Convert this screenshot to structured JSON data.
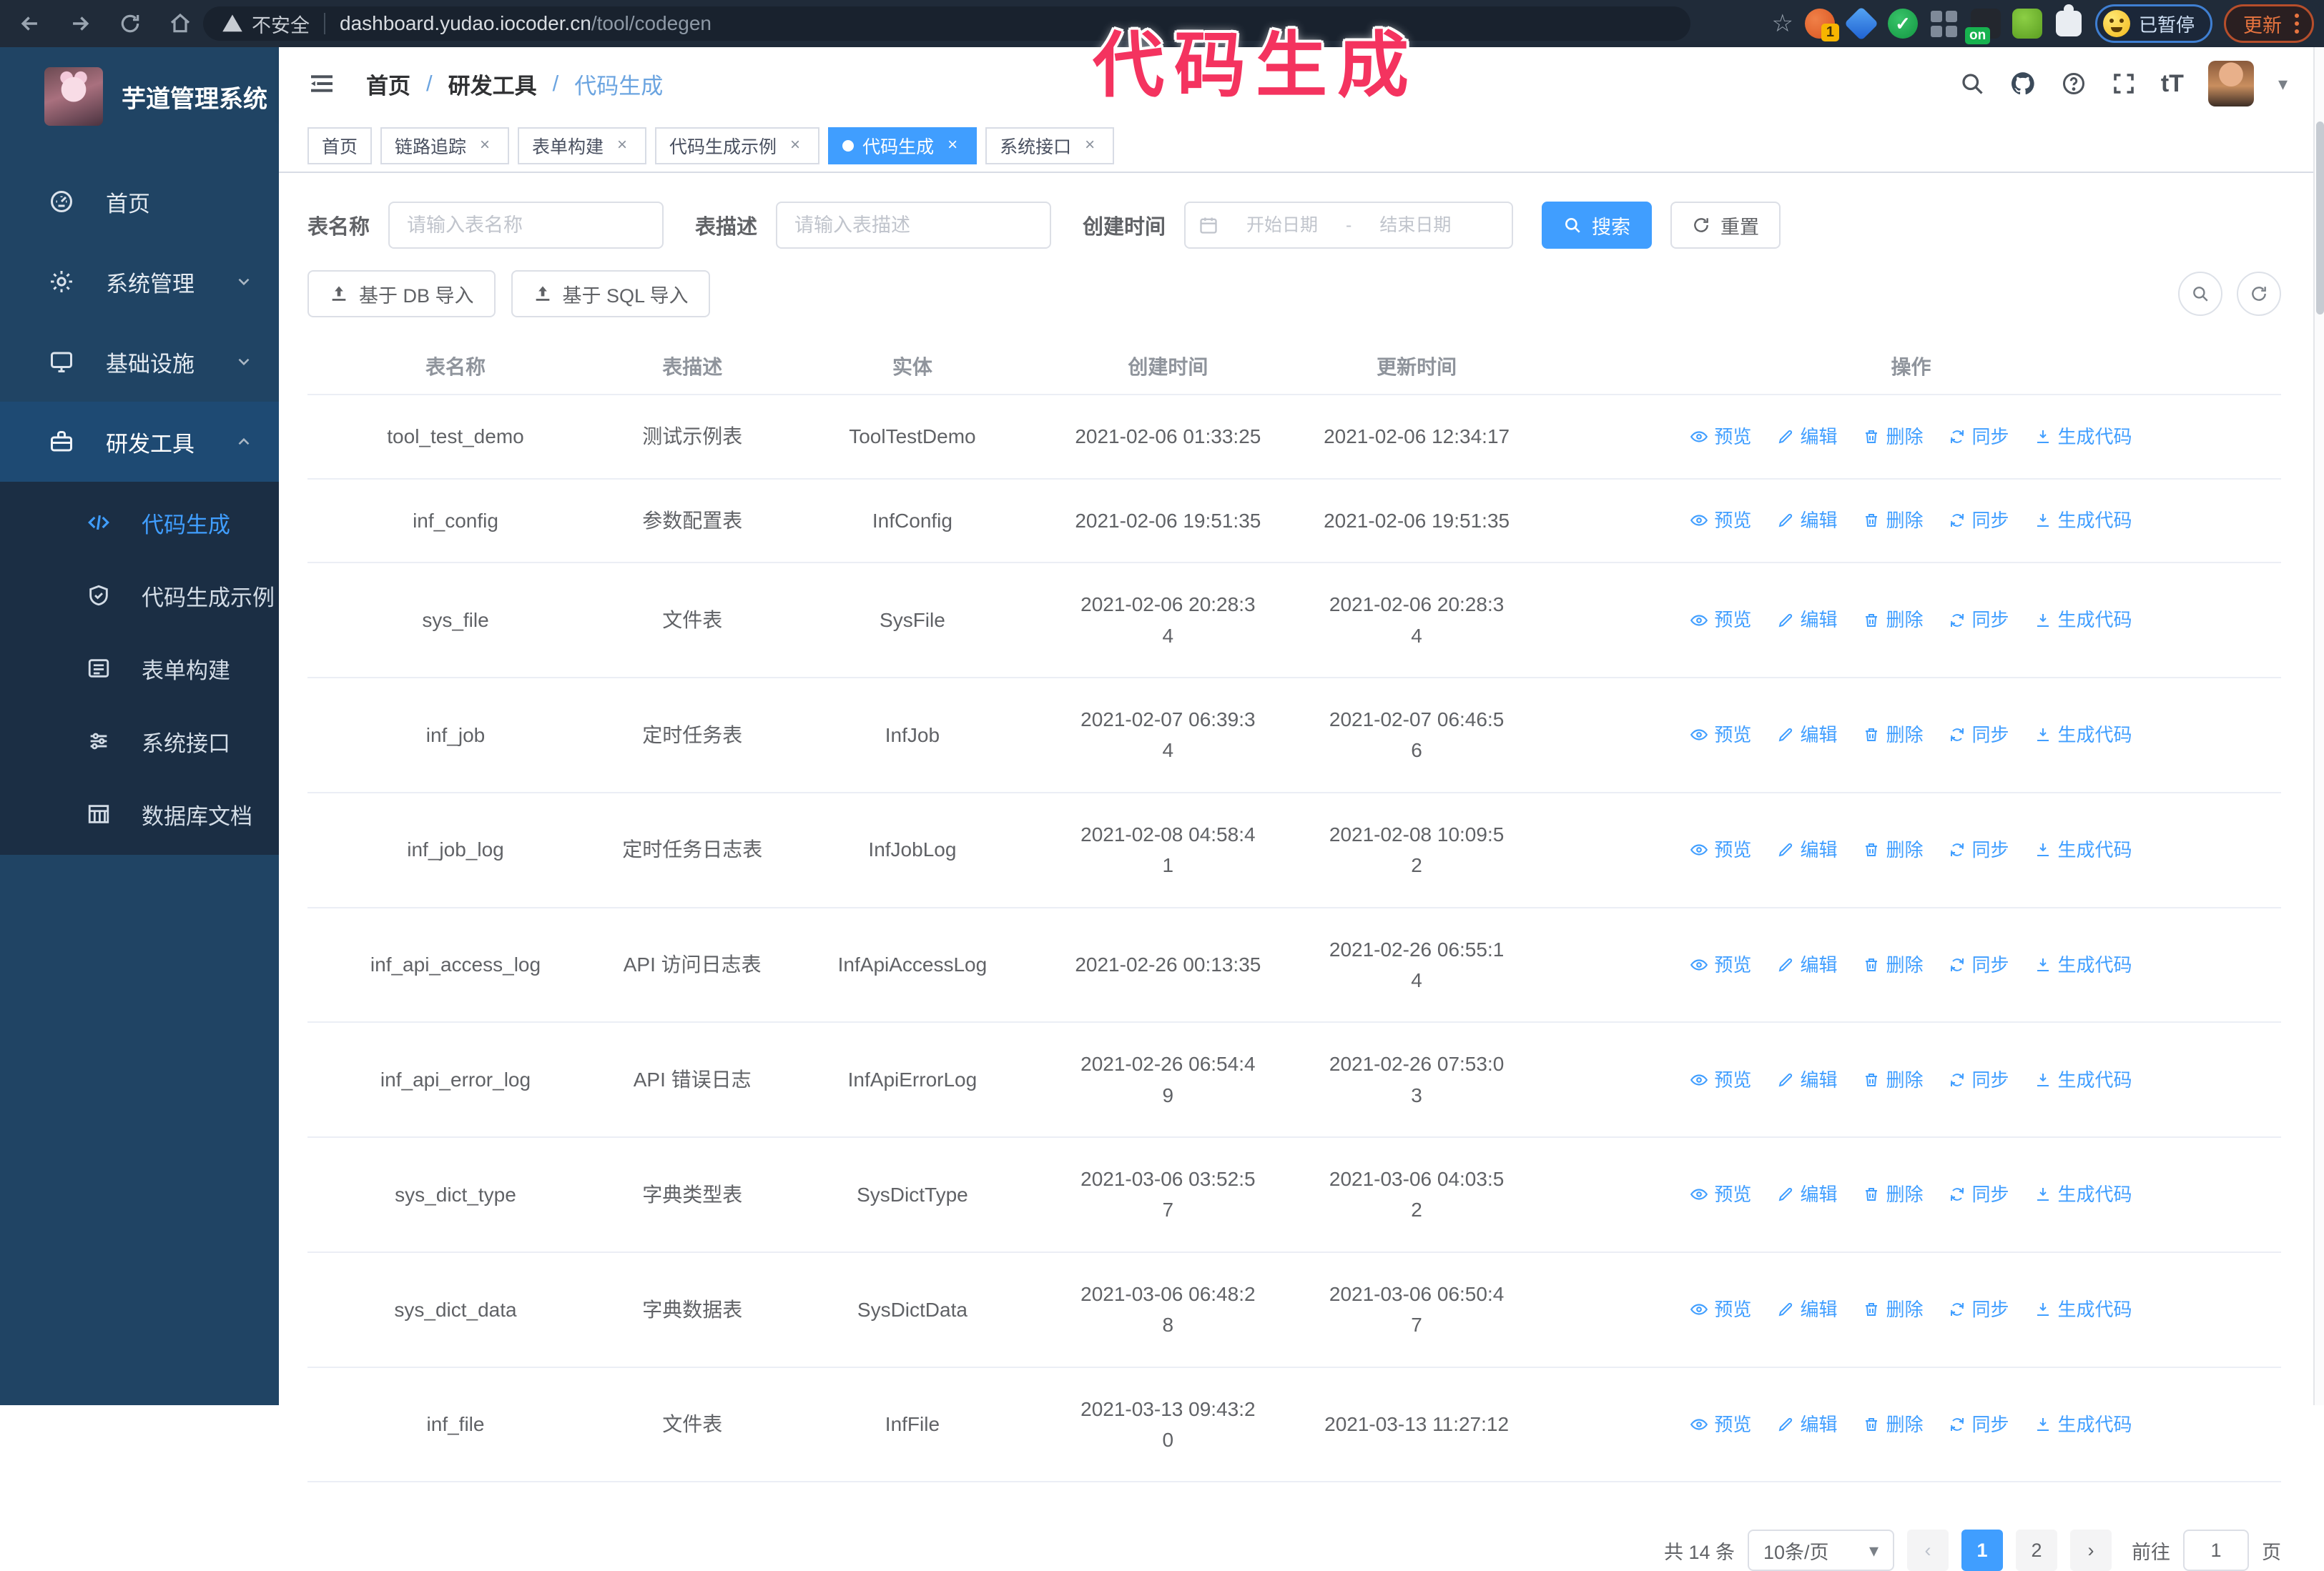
{
  "colors": {
    "accent": "#409eff",
    "annotation_pink": "#f4335f",
    "sidebar_bg": "#204464",
    "submenu_bg": "#1b2e44",
    "browser_bar_bg": "#202b39"
  },
  "icons": {
    "security": "warning-triangle",
    "preview": "eye",
    "edit": "pencil",
    "delete": "trash",
    "sync": "refresh-arrows",
    "generate": "download",
    "import": "upload",
    "search": "magnifier",
    "reset": "refresh",
    "date": "calendar",
    "help": "question-circle",
    "fullscreen": "expand-arrows",
    "font_size": "tT",
    "github": "octocat"
  },
  "browser": {
    "security_label": "不安全",
    "url_host": "dashboard.yudao.iocoder.cn",
    "url_path": "/tool/codegen",
    "extension_badge_count": "1",
    "extension_badge_on": "on",
    "paused_label": "已暂停",
    "update_label": "更新"
  },
  "annotation": {
    "text": "代码生成"
  },
  "sidebar": {
    "title": "芋道管理系统",
    "items": [
      {
        "label": "首页"
      },
      {
        "label": "系统管理",
        "chevron": "down"
      },
      {
        "label": "基础设施",
        "chevron": "down"
      },
      {
        "label": "研发工具",
        "chevron": "up",
        "expanded": true
      }
    ],
    "submenu": [
      {
        "label": "代码生成",
        "active": true
      },
      {
        "label": "代码生成示例"
      },
      {
        "label": "表单构建"
      },
      {
        "label": "系统接口"
      },
      {
        "label": "数据库文档"
      }
    ]
  },
  "header": {
    "breadcrumb": [
      "首页",
      "研发工具",
      "代码生成"
    ]
  },
  "tabs": [
    {
      "label": "首页"
    },
    {
      "label": "链路追踪",
      "closable": true
    },
    {
      "label": "表单构建",
      "closable": true
    },
    {
      "label": "代码生成示例",
      "closable": true
    },
    {
      "label": "代码生成",
      "closable": true,
      "state": "active",
      "active_dot": true
    },
    {
      "label": "系统接口",
      "closable": true
    }
  ],
  "filters": {
    "name_label": "表名称",
    "name_placeholder": "请输入表名称",
    "desc_label": "表描述",
    "desc_placeholder": "请输入表描述",
    "time_label": "创建时间",
    "start_placeholder": "开始日期",
    "range_separator": "-",
    "end_placeholder": "结束日期",
    "search_label": "搜索",
    "reset_label": "重置"
  },
  "toolbar": {
    "db_import_label": "基于 DB 导入",
    "sql_import_label": "基于 SQL 导入"
  },
  "table": {
    "columns": [
      "表名称",
      "表描述",
      "实体",
      "创建时间",
      "更新时间",
      "操作"
    ],
    "actions": [
      {
        "icon": "eye-icon",
        "label": "预览"
      },
      {
        "icon": "edit-icon",
        "label": "编辑"
      },
      {
        "icon": "trash-icon",
        "label": "删除"
      },
      {
        "icon": "sync-icon",
        "label": "同步"
      },
      {
        "icon": "download-icon",
        "label": "生成代码"
      }
    ],
    "rows": [
      {
        "name": "tool_test_demo",
        "desc": "测试示例表",
        "entity": "ToolTestDemo",
        "created": "2021-02-06 01:33:25",
        "updated": "2021-02-06 12:34:17"
      },
      {
        "name": "inf_config",
        "desc": "参数配置表",
        "entity": "InfConfig",
        "created": "2021-02-06 19:51:35",
        "updated": "2021-02-06 19:51:35"
      },
      {
        "name": "sys_file",
        "desc": "文件表",
        "entity": "SysFile",
        "created": "2021-02-06 20:28:3\n4",
        "updated": "2021-02-06 20:28:3\n4"
      },
      {
        "name": "inf_job",
        "desc": "定时任务表",
        "entity": "InfJob",
        "created": "2021-02-07 06:39:3\n4",
        "updated": "2021-02-07 06:46:5\n6"
      },
      {
        "name": "inf_job_log",
        "desc": "定时任务日志表",
        "entity": "InfJobLog",
        "created": "2021-02-08 04:58:4\n1",
        "updated": "2021-02-08 10:09:5\n2"
      },
      {
        "name": "inf_api_access_log",
        "desc": "API 访问日志表",
        "entity": "InfApiAccessLog",
        "created": "2021-02-26 00:13:35",
        "updated": "2021-02-26 06:55:1\n4"
      },
      {
        "name": "inf_api_error_log",
        "desc": "API 错误日志",
        "entity": "InfApiErrorLog",
        "created": "2021-02-26 06:54:4\n9",
        "updated": "2021-02-26 07:53:0\n3"
      },
      {
        "name": "sys_dict_type",
        "desc": "字典类型表",
        "entity": "SysDictType",
        "created": "2021-03-06 03:52:5\n7",
        "updated": "2021-03-06 04:03:5\n2"
      },
      {
        "name": "sys_dict_data",
        "desc": "字典数据表",
        "entity": "SysDictData",
        "created": "2021-03-06 06:48:2\n8",
        "updated": "2021-03-06 06:50:4\n7"
      },
      {
        "name": "inf_file",
        "desc": "文件表",
        "entity": "InfFile",
        "created": "2021-03-13 09:43:2\n0",
        "updated": "2021-03-13 11:27:12"
      }
    ]
  },
  "pagination": {
    "total": "共 14 条",
    "page_size": "10条/页",
    "pages": [
      "1",
      "2"
    ],
    "active_page": "1",
    "goto_label": "前往",
    "goto_value": "1",
    "unit_label": "页"
  }
}
